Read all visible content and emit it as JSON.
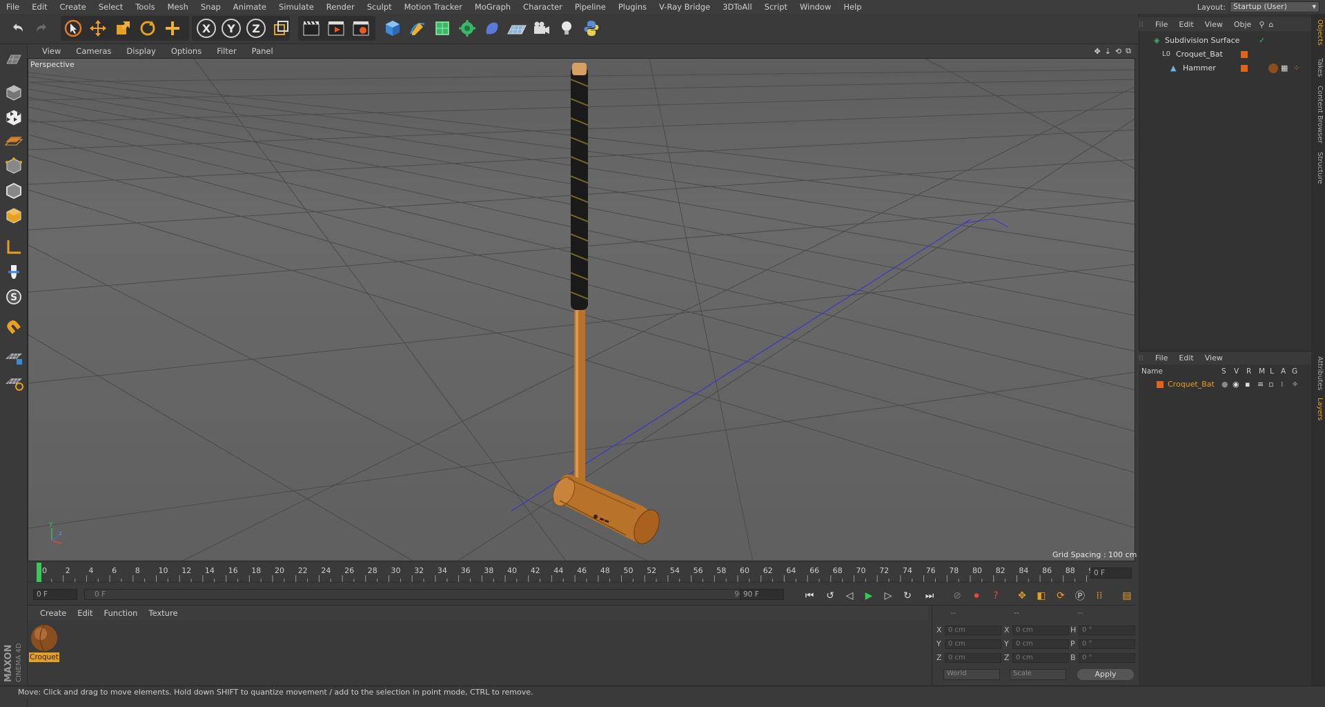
{
  "menubar": {
    "items": [
      "File",
      "Edit",
      "Create",
      "Select",
      "Tools",
      "Mesh",
      "Snap",
      "Animate",
      "Simulate",
      "Render",
      "Sculpt",
      "Motion Tracker",
      "MoGraph",
      "Character",
      "Pipeline",
      "Plugins",
      "V-Ray Bridge",
      "3DToAll",
      "Script",
      "Window",
      "Help"
    ],
    "layout_label": "Layout:",
    "layout_value": "Startup (User)"
  },
  "toolbar": {
    "axis_x": "X",
    "axis_y": "Y",
    "axis_z": "Z"
  },
  "viewport": {
    "menu": [
      "View",
      "Cameras",
      "Display",
      "Options",
      "Filter",
      "Panel"
    ],
    "label": "Perspective",
    "grid_spacing": "Grid Spacing : 100 cm",
    "axis_y_label": "y",
    "axis_z_label": "z"
  },
  "timeline": {
    "ticks": [
      "0",
      "2",
      "4",
      "6",
      "8",
      "10",
      "12",
      "14",
      "16",
      "18",
      "20",
      "22",
      "24",
      "26",
      "28",
      "30",
      "32",
      "34",
      "36",
      "38",
      "40",
      "42",
      "44",
      "46",
      "48",
      "50",
      "52",
      "54",
      "56",
      "58",
      "60",
      "62",
      "64",
      "66",
      "68",
      "70",
      "72",
      "74",
      "76",
      "78",
      "80",
      "82",
      "84",
      "86",
      "88",
      "90"
    ],
    "current_frame": "0 F",
    "start_frame": "0 F",
    "range_start": "0 F",
    "range_end": "90 F",
    "end_frame": "90 F"
  },
  "material_manager": {
    "menu": [
      "Create",
      "Edit",
      "Function",
      "Texture"
    ],
    "material_name": "Croquet"
  },
  "coordinates": {
    "header": [
      "--",
      "--",
      "--"
    ],
    "rows": [
      {
        "l1": "X",
        "v1": "0 cm",
        "l2": "X",
        "v2": "0 cm",
        "l3": "H",
        "v3": "0 °"
      },
      {
        "l1": "Y",
        "v1": "0 cm",
        "l2": "Y",
        "v2": "0 cm",
        "l3": "P",
        "v3": "0 °"
      },
      {
        "l1": "Z",
        "v1": "0 cm",
        "l2": "Z",
        "v2": "0 cm",
        "l3": "B",
        "v3": "0 °"
      }
    ],
    "coord_system": "World",
    "mode": "Scale",
    "apply": "Apply"
  },
  "object_manager": {
    "menu": [
      "File",
      "Edit",
      "View",
      "Obje"
    ],
    "objects": [
      {
        "name": "Subdivision Surface",
        "indent": 0
      },
      {
        "name": "Croquet_Bat",
        "indent": 1
      },
      {
        "name": "Hammer",
        "indent": 2
      }
    ]
  },
  "layer_manager": {
    "menu": [
      "File",
      "Edit",
      "View"
    ],
    "columns": [
      "Name",
      "S",
      "V",
      "R",
      "M",
      "L",
      "A",
      "G"
    ],
    "layers": [
      {
        "name": "Croquet_Bat"
      }
    ]
  },
  "side_tabs": [
    "Objects",
    "Takes",
    "Content Browser",
    "Structure",
    "Attributes",
    "Layers"
  ],
  "status": "Move: Click and drag to move elements. Hold down SHIFT to quantize movement / add to the selection in point mode, CTRL to remove.",
  "brand": {
    "maxon": "MAXON",
    "product": "CINEMA 4D"
  },
  "colors": {
    "accent": "#e8a020",
    "layer_orange": "#e0641e",
    "handle_dark": "#1a1a1a",
    "wood": "#b8722a"
  }
}
